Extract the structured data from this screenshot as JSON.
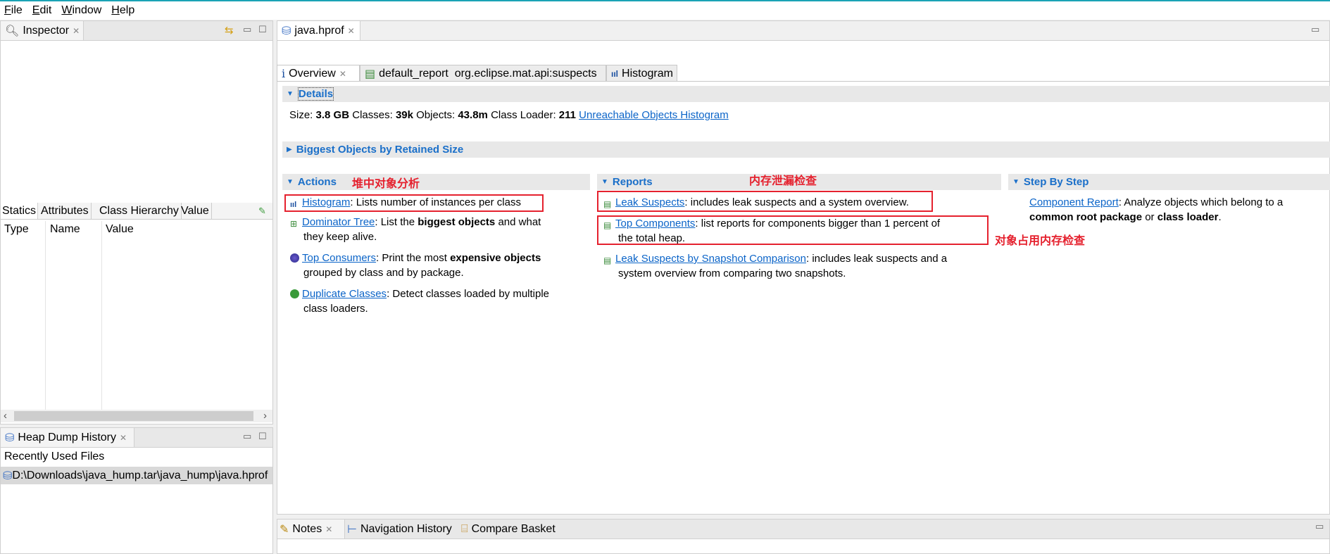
{
  "menu": [
    "File",
    "Edit",
    "Window",
    "Help"
  ],
  "inspector": {
    "title": "Inspector",
    "tabs": [
      "Statics",
      "Attributes",
      "Class Hierarchy",
      "Value"
    ],
    "columns": [
      "Type",
      "Name",
      "Value"
    ]
  },
  "history": {
    "title": "Heap Dump History",
    "section": "Recently Used Files",
    "files": [
      "D:\\Downloads\\java_hump.tar\\java_hump\\java.hprof"
    ]
  },
  "editor": {
    "title": "java.hprof",
    "tabs": [
      "Overview",
      "default_report  org.eclipse.mat.api:suspects",
      "Histogram"
    ]
  },
  "details": {
    "header": "Details",
    "size_label": "Size:",
    "size": "3.8 GB",
    "classes_label": "Classes:",
    "classes": "39k",
    "objects_label": "Objects:",
    "objects": "43.8m",
    "loader_label": "Class Loader:",
    "loader": "211",
    "unreachable_link": "Unreachable Objects Histogram"
  },
  "biggest": {
    "header": "Biggest Objects by Retained Size"
  },
  "actions": {
    "header": "Actions",
    "annotation": "堆中对象分析",
    "histogram": {
      "link": "Histogram",
      "text": ": Lists number of instances per class"
    },
    "dominator": {
      "link": "Dominator Tree",
      "t1": ": List the ",
      "b1": "biggest objects",
      "t2": " and what",
      "l2": "they keep alive."
    },
    "consumers": {
      "link": "Top Consumers",
      "t1": ": Print the most ",
      "b1": "expensive objects",
      "l2": "grouped by class and by package."
    },
    "duplicates": {
      "link": "Duplicate Classes",
      "t1": ": Detect classes loaded by multiple",
      "l2": "class loaders."
    }
  },
  "reports": {
    "header": "Reports",
    "annotation_leak": "内存泄漏检查",
    "annotation_components": "对象占用内存检查",
    "leak": {
      "link": "Leak Suspects",
      "text": ": includes leak suspects and a system overview."
    },
    "components": {
      "link": "Top Components",
      "t1": ": list reports for components bigger than 1 percent of",
      "l2": "the total heap."
    },
    "comparison": {
      "link": "Leak Suspects by Snapshot Comparison",
      "t1": ": includes leak suspects and a",
      "l2": "system overview from comparing two snapshots."
    }
  },
  "step": {
    "header": "Step By Step",
    "link": "Component Report",
    "t1": ": Analyze objects which belong to a",
    "b1": "common root package",
    "t2": " or ",
    "b2": "class loader",
    "t3": "."
  },
  "bottom": {
    "tabs": [
      "Notes",
      "Navigation History",
      "Compare Basket"
    ]
  }
}
